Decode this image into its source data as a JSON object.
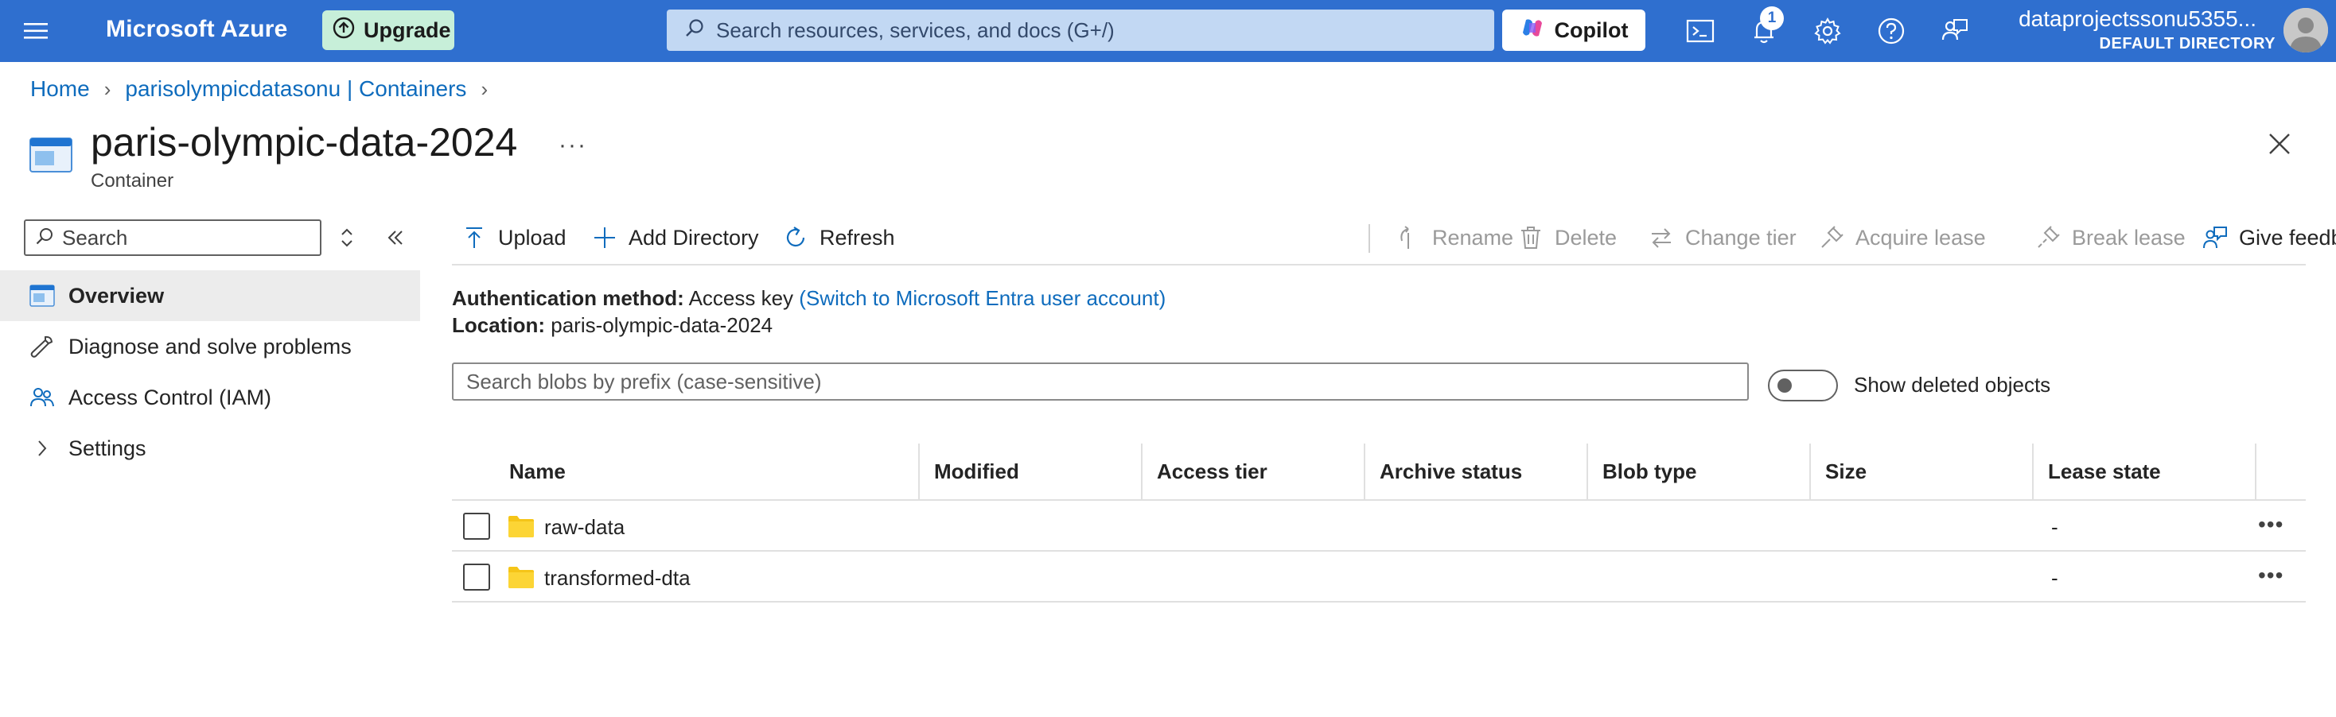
{
  "topbar": {
    "brand": "Microsoft Azure",
    "upgrade_label": "Upgrade",
    "search_placeholder": "Search resources, services, and docs (G+/)",
    "copilot_label": "Copilot",
    "notification_count": "1",
    "account_name": "dataprojectssonu5355...",
    "account_directory": "DEFAULT DIRECTORY",
    "bar_color": "#2f6fcf"
  },
  "breadcrumb": {
    "home": "Home",
    "parent": "parisolympicdatasonu | Containers"
  },
  "resource": {
    "title": "paris-olympic-data-2024",
    "subtitle": "Container",
    "more": "···"
  },
  "nav": {
    "search_placeholder": "Search",
    "items": [
      {
        "label": "Overview",
        "icon": "container-overview-icon",
        "active": true
      },
      {
        "label": "Diagnose and solve problems",
        "icon": "wrench-icon",
        "active": false
      },
      {
        "label": "Access Control (IAM)",
        "icon": "people-icon",
        "active": false
      },
      {
        "label": "Settings",
        "icon": "chevron-right-icon",
        "active": false
      }
    ]
  },
  "toolbar": {
    "upload": "Upload",
    "add_directory": "Add Directory",
    "refresh": "Refresh",
    "rename": "Rename",
    "delete": "Delete",
    "change_tier": "Change tier",
    "acquire_lease": "Acquire lease",
    "break_lease": "Break lease",
    "give_feedback": "Give feedback"
  },
  "info": {
    "auth_label": "Authentication method:",
    "auth_value": "Access key",
    "auth_link": "(Switch to Microsoft Entra user account)",
    "location_label": "Location:",
    "location_value": "paris-olympic-data-2024"
  },
  "blob_search_placeholder": "Search blobs by prefix (case-sensitive)",
  "show_deleted_label": "Show deleted objects",
  "table": {
    "columns": [
      "Name",
      "Modified",
      "Access tier",
      "Archive status",
      "Blob type",
      "Size",
      "Lease state"
    ],
    "rows": [
      {
        "name": "raw-data",
        "modified": "",
        "access_tier": "",
        "archive_status": "",
        "blob_type": "",
        "size": "",
        "lease_state": "-"
      },
      {
        "name": "transformed-dta",
        "modified": "",
        "access_tier": "",
        "archive_status": "",
        "blob_type": "",
        "size": "",
        "lease_state": "-"
      }
    ]
  }
}
